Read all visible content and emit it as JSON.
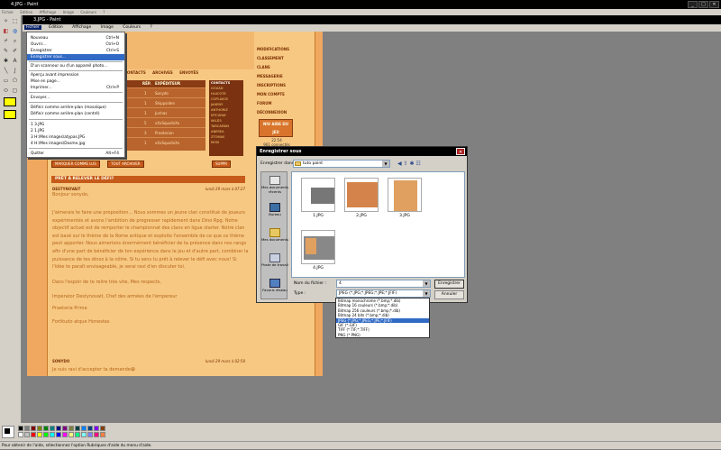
{
  "outer": {
    "title": "4.JPG - Paint",
    "menu": [
      "Fichier",
      "Edition",
      "Affichage",
      "Image",
      "Couleurs",
      "?"
    ],
    "controls": [
      "_",
      "□",
      "✕"
    ]
  },
  "inner": {
    "title": "3.JPG - Paint",
    "menu": [
      "Fichier",
      "Edition",
      "Affichage",
      "Image",
      "Couleurs",
      "?"
    ]
  },
  "file_menu": {
    "items": [
      {
        "label": "Nouveau",
        "shortcut": "Ctrl+N"
      },
      {
        "label": "Ouvrir...",
        "shortcut": "Ctrl+O"
      },
      {
        "label": "Enregistrer",
        "shortcut": "Ctrl+S"
      },
      {
        "label": "Enregistrer sous...",
        "shortcut": ""
      },
      {
        "label": "D'un scanneur ou d'un appareil photo...",
        "shortcut": ""
      },
      {
        "label": "Aperçu avant impression",
        "shortcut": ""
      },
      {
        "label": "Mise en page...",
        "shortcut": ""
      },
      {
        "label": "Imprimer...",
        "shortcut": "Ctrl+P"
      },
      {
        "label": "Envoyer...",
        "shortcut": ""
      },
      {
        "label": "Définir comme arrière-plan (mosaïque)",
        "shortcut": ""
      },
      {
        "label": "Définir comme arrière-plan (centré)",
        "shortcut": ""
      },
      {
        "label": "1 3.JPG",
        "shortcut": ""
      },
      {
        "label": "2 1.JPG",
        "shortcut": ""
      },
      {
        "label": "3 H:\\Mes images\\atypas.JPG",
        "shortcut": ""
      },
      {
        "label": "4 H:\\Mes images\\Dasme.jpg",
        "shortcut": ""
      },
      {
        "label": "Quitter",
        "shortcut": "Alt+F4"
      }
    ]
  },
  "forum": {
    "tabs": [
      "CONTACTS",
      "ARCHIVES",
      "ENVOYÉS"
    ],
    "table_head": [
      "RÉP.",
      "EXPÉDITEUR"
    ],
    "rows": [
      {
        "n": "1",
        "sender": "Sonydo"
      },
      {
        "n": "1",
        "sender": "Shippsiden"
      },
      {
        "n": "1",
        "sender": "Junhas"
      },
      {
        "n": "5",
        "sender": "xXxSquallxXx"
      },
      {
        "n": "3",
        "sender": "Praetorian"
      },
      {
        "n": "1",
        "sender": "xXxSquallxXx"
      }
    ],
    "contacts_title": "CONTACTS",
    "contacts": [
      "GOUAD",
      "HL0COTE",
      "COPLA005",
      "JAHENY",
      "ANTHORIZ",
      "MTCURAY",
      "WILD3",
      "TARCAMAN",
      "ANEREA",
      "ZTOMAS",
      "MOIS"
    ],
    "right_menu": [
      "MODIFICATIONS",
      "CLASSEMENT",
      "CLANS",
      "MESSAGERIE",
      "INSCRIPTIONS",
      "MON COMPTE",
      "FORUM",
      "DÉCONNEXION"
    ],
    "right_button": "NIV AIDE DU JEU",
    "time": "22:54",
    "connected": "961 connectés",
    "mark_buttons": [
      "MARQUER COMME LUS",
      "TOUT ARCHIVER",
      "SUPPR"
    ],
    "post_title": "PRÊT À RELEVER LE DÉFI?",
    "post_author": "DESTYNOVAIT",
    "post_date": "lundi 29 mars à 07:27",
    "post_greeting": "Bonjour sonydo,",
    "post_paragraphs": [
      "J'aimerais te faire une proposition... Nous sommes un jeune clan constitué de joueurs expérimentés et avons l'ambition de progresser rapidement dans Dino Rpg. Notre objectif actuel est de remporter le championnat des clans en ligue starter. Notre clan est basé sur le thème de la Rome antique et exploite l'ensemble de ce que ce thème peut apporter. Nous aimerions énormément bénéficier de ta présence dans nos rangs afin d'une part de bénéficier de ton expérience dans le jeu et d'autre part, combiner la puissance de tes dinoz à la nôtre. Si tu sens tu prêt à relever le défi avec nous! Si l'idée te paraît envisageable, je serai ravi d'en discuter toi.",
      "Dans l'espoir de te relire très vite, Mes respects,",
      "Imperator Destynovait, Chef des armées de l'empereur",
      "Praetoria Prima",
      "Fortitudo atque Honestas"
    ],
    "post2_author": "SONYDO",
    "post2_date": "lundi 29 mars à 02:58",
    "post2_text": "Je suis ravi d'accepter ta demande😁"
  },
  "dialog": {
    "title": "Enregistrer sous",
    "save_in_label": "Enregistrer dans :",
    "save_in_value": "tuto paint",
    "places": [
      "Mes documents récents",
      "Bureau",
      "Mes documents",
      "Poste de travail",
      "Favoris réseau"
    ],
    "files": [
      "1.JPG",
      "2.JPG",
      "3.JPG",
      "4.JPG"
    ],
    "filename_label": "Nom du fichier :",
    "filename_value": "4",
    "type_label": "Type :",
    "type_value": "JPEG (*.JPG;*.JPEG;*.JPE;*.JFIF)",
    "save_button": "Enregistrer",
    "cancel_button": "Annuler",
    "type_options": [
      "Bitmap monochrome (*.bmp;*.dib)",
      "Bitmap 16 couleurs (*.bmp;*.dib)",
      "Bitmap 256 couleurs (*.bmp;*.dib)",
      "Bitmap 24 bits (*.bmp;*.dib)",
      "JPEG (*.JPG;*.JPEG;*.JPE;*.JFIF)",
      "GIF (*.GIF)",
      "TIFF (*.TIF;*.TIFF)",
      "PNG (*.PNG)"
    ],
    "type_selected": 4
  },
  "status": "Pour obtenir de l'aide, sélectionnez l'option Rubriques d'aide du menu d'aide.",
  "palette": [
    "#000000",
    "#808080",
    "#800000",
    "#808000",
    "#008000",
    "#008080",
    "#000080",
    "#800080",
    "#808040",
    "#004040",
    "#0080ff",
    "#004080",
    "#8000ff",
    "#804000",
    "#ffffff",
    "#c0c0c0",
    "#ff0000",
    "#ffff00",
    "#00ff00",
    "#00ffff",
    "#0000ff",
    "#ff00ff",
    "#ffff80",
    "#00ff80",
    "#80ffff",
    "#8080ff",
    "#ff0080",
    "#ff8040"
  ]
}
